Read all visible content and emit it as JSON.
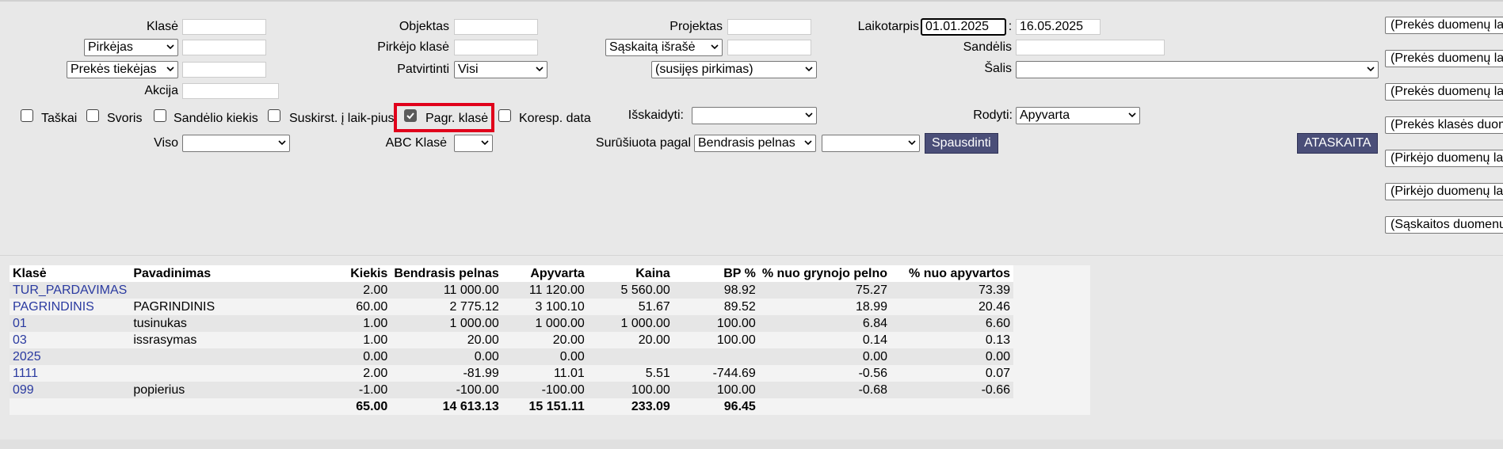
{
  "filters": {
    "klase_label": "Klasė",
    "customer_select": "Pirkėjas",
    "supplier_select": "Prekės tiekėjas",
    "akcija_label": "Akcija",
    "objektas_label": "Objektas",
    "pirkejo_klase_label": "Pirkėjo klasė",
    "patvirtinti_label": "Patvirtinti",
    "patvirtinti_value": "Visi",
    "projektas_label": "Projektas",
    "invoice_select": "Sąskaitą išrašė",
    "related_select": "(susijęs pirkimas)",
    "laikotarpis_label": "Laikotarpis",
    "date_from": "01.01.2025",
    "date_sep": ":",
    "date_to": "16.05.2025",
    "sandelis_label": "Sandėlis",
    "salis_label": "Šalis",
    "viso_label": "Viso",
    "abc_label": "ABC Klasė",
    "isskaidyti_label": "Išskaidyti:",
    "rodyti_label": "Rodyti:",
    "rodyti_value": "Apyvarta",
    "surusiuota_label": "Surūšiuota pagal",
    "sort_value": "Bendrasis pelnas",
    "print_button": "Spausdinti",
    "report_button": "ATASKAITA"
  },
  "checkboxes": [
    {
      "label": "Taškai",
      "checked": false
    },
    {
      "label": "Svoris",
      "checked": false
    },
    {
      "label": "Sandėlio kiekis",
      "checked": false
    },
    {
      "label": "Suskirst. į laik-pius",
      "checked": false
    },
    {
      "label": "Pagr. klasė",
      "checked": true
    },
    {
      "label": "Koresp. data",
      "checked": false
    }
  ],
  "right_panel": [
    "(Prekės duomenų la",
    "(Prekės duomenų la",
    "(Prekės duomenų la",
    "(Prekės klasės duom",
    "(Pirkėjo duomenų la",
    "(Pirkėjo duomenų la",
    "(Sąskaitos duomenų"
  ],
  "table": {
    "headers": [
      "Klasė",
      "Pavadinimas",
      "Kiekis",
      "Bendrasis pelnas",
      "Apyvarta",
      "Kaina",
      "BP %",
      "% nuo grynojo pelno",
      "% nuo apyvartos"
    ],
    "rows": [
      [
        "TUR_PARDAVIMAS",
        "",
        "2.00",
        "11 000.00",
        "11 120.00",
        "5 560.00",
        "98.92",
        "75.27",
        "73.39"
      ],
      [
        "PAGRINDINIS",
        "PAGRINDINIS",
        "60.00",
        "2 775.12",
        "3 100.10",
        "51.67",
        "89.52",
        "18.99",
        "20.46"
      ],
      [
        "01",
        "tusinukas",
        "1.00",
        "1 000.00",
        "1 000.00",
        "1 000.00",
        "100.00",
        "6.84",
        "6.60"
      ],
      [
        "03",
        "issrasymas",
        "1.00",
        "20.00",
        "20.00",
        "20.00",
        "100.00",
        "0.14",
        "0.13"
      ],
      [
        "2025",
        "",
        "0.00",
        "0.00",
        "0.00",
        "",
        "",
        "0.00",
        "0.00"
      ],
      [
        "1111",
        "",
        "2.00",
        "-81.99",
        "11.01",
        "5.51",
        "-744.69",
        "-0.56",
        "0.07"
      ],
      [
        "099",
        "popierius",
        "-1.00",
        "-100.00",
        "-100.00",
        "100.00",
        "100.00",
        "-0.68",
        "-0.66"
      ]
    ],
    "totals": [
      "",
      "",
      "65.00",
      "14 613.13",
      "15 151.11",
      "233.09",
      "96.45",
      "",
      ""
    ]
  }
}
